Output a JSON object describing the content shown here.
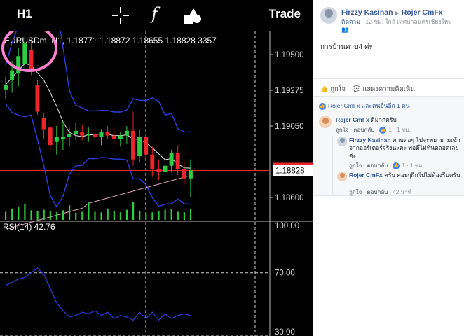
{
  "toolbar": {
    "timeframe": "H1",
    "crosshair_icon": "crosshair-icon",
    "indicator_glyph": "f",
    "indicator_icon": "function-icon",
    "objects_icon": "objects-icon",
    "trade_label": "Trade"
  },
  "chart": {
    "header_text": "EURUSDm, H1, 1.18771 1.18872 1.18655 1.18828 3357",
    "price_labels": [
      "1.19500",
      "1.19275",
      "1.19050",
      "1.18600"
    ],
    "current_price": "1.18828",
    "rsi_label": "RSI(14) 42.76",
    "rsi_levels": [
      "100.00",
      "70.00",
      "30.00"
    ],
    "colors": {
      "bull": "#2ecc40",
      "bear": "#e8262b",
      "bands": "#2b3ee0",
      "price_line": "#e8262b",
      "annotation": "#ff80d0"
    }
  },
  "chart_data": {
    "type": "candlestick",
    "symbol": "EURUSDm",
    "timeframe": "H1",
    "ylim": [
      1.1845,
      1.1965
    ],
    "yticks": [
      1.195,
      1.19275,
      1.1905,
      1.186
    ],
    "candles": [
      {
        "o": 1.1928,
        "h": 1.1936,
        "l": 1.1922,
        "c": 1.1931
      },
      {
        "o": 1.1934,
        "h": 1.1946,
        "l": 1.1926,
        "c": 1.194
      },
      {
        "o": 1.1938,
        "h": 1.1954,
        "l": 1.193,
        "c": 1.1949
      },
      {
        "o": 1.1944,
        "h": 1.1962,
        "l": 1.194,
        "c": 1.1957
      },
      {
        "o": 1.1953,
        "h": 1.196,
        "l": 1.1937,
        "c": 1.194
      },
      {
        "o": 1.1931,
        "h": 1.1934,
        "l": 1.1912,
        "c": 1.1914
      },
      {
        "o": 1.191,
        "h": 1.1913,
        "l": 1.1897,
        "c": 1.1903
      },
      {
        "o": 1.1904,
        "h": 1.1906,
        "l": 1.1889,
        "c": 1.1893
      },
      {
        "o": 1.1895,
        "h": 1.1905,
        "l": 1.1887,
        "c": 1.1898
      },
      {
        "o": 1.1897,
        "h": 1.1908,
        "l": 1.189,
        "c": 1.1898
      },
      {
        "o": 1.1898,
        "h": 1.1904,
        "l": 1.1892,
        "c": 1.19
      },
      {
        "o": 1.19,
        "h": 1.1907,
        "l": 1.1896,
        "c": 1.1902
      },
      {
        "o": 1.1901,
        "h": 1.1906,
        "l": 1.1896,
        "c": 1.1899
      },
      {
        "o": 1.1899,
        "h": 1.1904,
        "l": 1.1895,
        "c": 1.19
      },
      {
        "o": 1.19,
        "h": 1.1904,
        "l": 1.1896,
        "c": 1.1898
      },
      {
        "o": 1.1898,
        "h": 1.1903,
        "l": 1.1893,
        "c": 1.1901
      },
      {
        "o": 1.1901,
        "h": 1.1905,
        "l": 1.1897,
        "c": 1.1899
      },
      {
        "o": 1.1899,
        "h": 1.1904,
        "l": 1.1894,
        "c": 1.1897
      },
      {
        "o": 1.1897,
        "h": 1.1901,
        "l": 1.1892,
        "c": 1.1899
      },
      {
        "o": 1.1899,
        "h": 1.1905,
        "l": 1.1894,
        "c": 1.1902
      },
      {
        "o": 1.1902,
        "h": 1.1914,
        "l": 1.188,
        "c": 1.1884
      },
      {
        "o": 1.1886,
        "h": 1.1903,
        "l": 1.1882,
        "c": 1.1898
      },
      {
        "o": 1.1898,
        "h": 1.1902,
        "l": 1.1885,
        "c": 1.1887
      },
      {
        "o": 1.1887,
        "h": 1.1892,
        "l": 1.1873,
        "c": 1.1878
      },
      {
        "o": 1.1878,
        "h": 1.1884,
        "l": 1.1871,
        "c": 1.1876
      },
      {
        "o": 1.1876,
        "h": 1.1885,
        "l": 1.187,
        "c": 1.188
      },
      {
        "o": 1.188,
        "h": 1.189,
        "l": 1.1876,
        "c": 1.1888
      },
      {
        "o": 1.1888,
        "h": 1.1893,
        "l": 1.1874,
        "c": 1.1878
      },
      {
        "o": 1.1878,
        "h": 1.1882,
        "l": 1.1868,
        "c": 1.1872
      },
      {
        "o": 1.1872,
        "h": 1.1884,
        "l": 1.186,
        "c": 1.1877
      }
    ],
    "volume_relative": [
      0.32,
      0.45,
      0.5,
      0.62,
      0.38,
      0.36,
      0.4,
      0.34,
      0.3,
      0.38,
      0.58,
      0.28,
      0.32,
      0.7,
      0.32,
      0.3,
      0.45,
      0.34,
      0.3,
      0.4,
      0.72,
      0.34,
      0.28,
      0.3,
      0.36,
      0.4,
      0.42,
      0.32,
      0.3,
      0.42
    ],
    "rsi": {
      "ylim": [
        30,
        100
      ],
      "levels": [
        30,
        70,
        100
      ],
      "values": [
        62,
        64,
        66,
        67,
        70,
        73,
        69,
        60,
        51,
        46,
        42,
        43,
        45,
        44,
        46,
        43,
        45,
        41,
        43,
        42,
        40,
        45,
        41,
        45,
        40,
        44,
        41,
        43,
        44,
        43
      ]
    }
  },
  "post": {
    "author": "Firzzy Kasinan",
    "target": "Rojer CmFx",
    "follow": "ติดตาม",
    "meta": "12 ชม. ใกล้ เทศบาลนครเชียงใหม่",
    "privacy_icon": "friends-icon",
    "text": "การบ้านคาบ4 ค่ะ",
    "like_label": "ถูกใจ",
    "comment_label": "แสดงความคิดเห็น",
    "likes_summary": "Rojer CmFx และคนอื่นอีก 1 คน"
  },
  "comments": [
    {
      "author": "Rojer CmFx",
      "text": "ดีมากครับ",
      "like": "ถูกใจ",
      "reply": "ตอบกลับ",
      "count": "1",
      "time": "1 ชม."
    },
    {
      "author": "Firzzy Kasinan",
      "text": "คาบต่อๆ ไปจะพยายามเข้าจากออร์เดอร์จริงนะคะ พอดีไม่ทันตลอดเลย ค่ะ",
      "like": "ถูกใจ",
      "reply": "ตอบกลับ",
      "count": "1",
      "time": "1 ชม."
    },
    {
      "author": "Rojer CmFx",
      "text": "ครับ ค่อยๆฝึกไปไม่ต้องรีบครับ",
      "like": "ถูกใจ",
      "reply": "ตอบกลับ",
      "time": "42 นาที"
    }
  ]
}
